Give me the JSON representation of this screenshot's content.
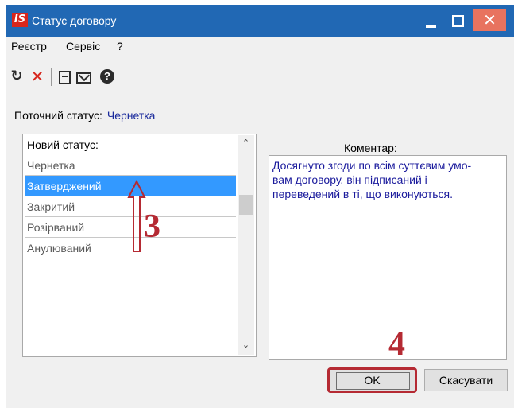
{
  "window": {
    "title": "Статус договору",
    "logo_text": "IS",
    "close_glyph": "✕"
  },
  "menu": {
    "items": [
      "Реєстр",
      "Сервіс",
      "?"
    ]
  },
  "toolbar": {
    "icons": [
      "refresh-icon",
      "delete-icon",
      "document-icon",
      "mail-icon",
      "help-icon"
    ],
    "refresh_glyph": "↻",
    "delete_glyph": "✕",
    "help_glyph": "?"
  },
  "current_status": {
    "label": "Поточний статус:",
    "value": "Чернетка"
  },
  "status_list": {
    "header": "Новий статус:",
    "items": [
      "Чернетка",
      "Затверджений",
      "Закритий",
      "Розірваний",
      "Анулюваний"
    ],
    "selected": "Затверджений",
    "scroll_up_glyph": "⌃",
    "scroll_down_glyph": "⌄"
  },
  "comment": {
    "label": "Коментар:",
    "lines": [
      "Досягнуто згоди по всім суттєвим умо-",
      "вам договору, він підписаний і",
      "переведений в ті, що виконуються."
    ]
  },
  "buttons": {
    "ok": "OK",
    "cancel": "Скасувати"
  },
  "annotations": {
    "step3": "3",
    "step4": "4",
    "color": "#b52a33"
  },
  "colors": {
    "titlebar": "#2168b4",
    "selection": "#3399ff",
    "status_value": "#1a2a9c",
    "close": "#e8735f"
  }
}
